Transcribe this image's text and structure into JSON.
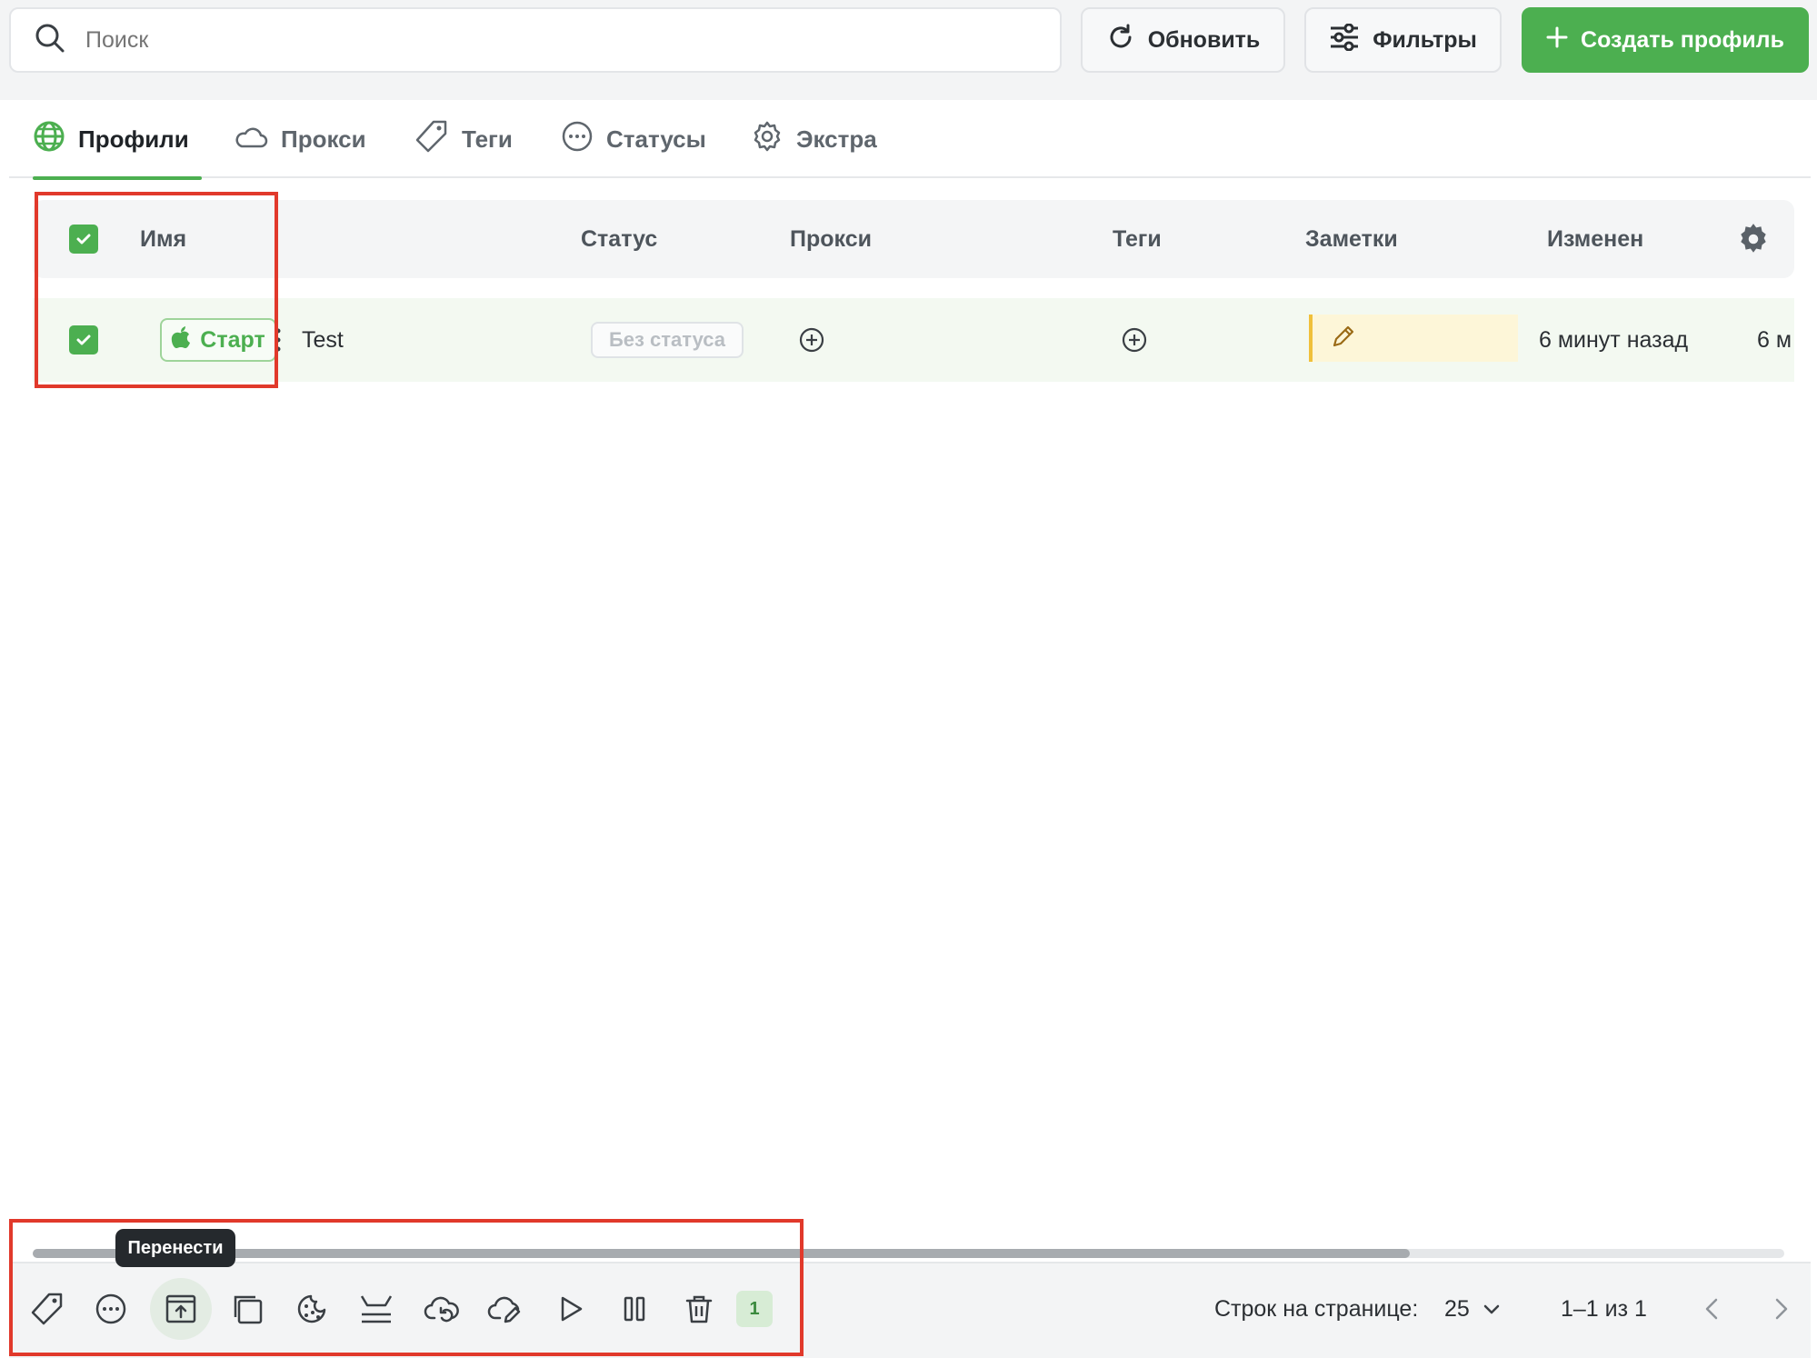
{
  "search": {
    "placeholder": "Поиск"
  },
  "toolbar": {
    "refresh_label": "Обновить",
    "filters_label": "Фильтры",
    "create_label": "Создать профиль"
  },
  "tabs": [
    {
      "label": "Профили",
      "icon": "globe-icon",
      "active": true
    },
    {
      "label": "Прокси",
      "icon": "cloud-icon",
      "active": false
    },
    {
      "label": "Теги",
      "icon": "tag-icon",
      "active": false
    },
    {
      "label": "Статусы",
      "icon": "dots-circle-icon",
      "active": false
    },
    {
      "label": "Экстра",
      "icon": "gear-icon",
      "active": false
    }
  ],
  "table": {
    "columns": [
      "Имя",
      "Статус",
      "Прокси",
      "Теги",
      "Заметки",
      "Изменен"
    ],
    "rows": [
      {
        "checked": true,
        "start_label": "Старт",
        "os_icon": "apple-icon",
        "name": "Test",
        "status": "Без статуса",
        "modified": "6 минут назад",
        "next_col_partial": "6 м"
      }
    ]
  },
  "footer": {
    "tooltip": "Перенести",
    "selected_count": "1",
    "rows_per_page_label": "Строк на странице:",
    "rows_per_page_value": "25",
    "pagination": "1–1 из 1"
  },
  "colors": {
    "accent": "#4caf50",
    "highlight": "#e1392b",
    "notes": "#fdf6d8"
  }
}
